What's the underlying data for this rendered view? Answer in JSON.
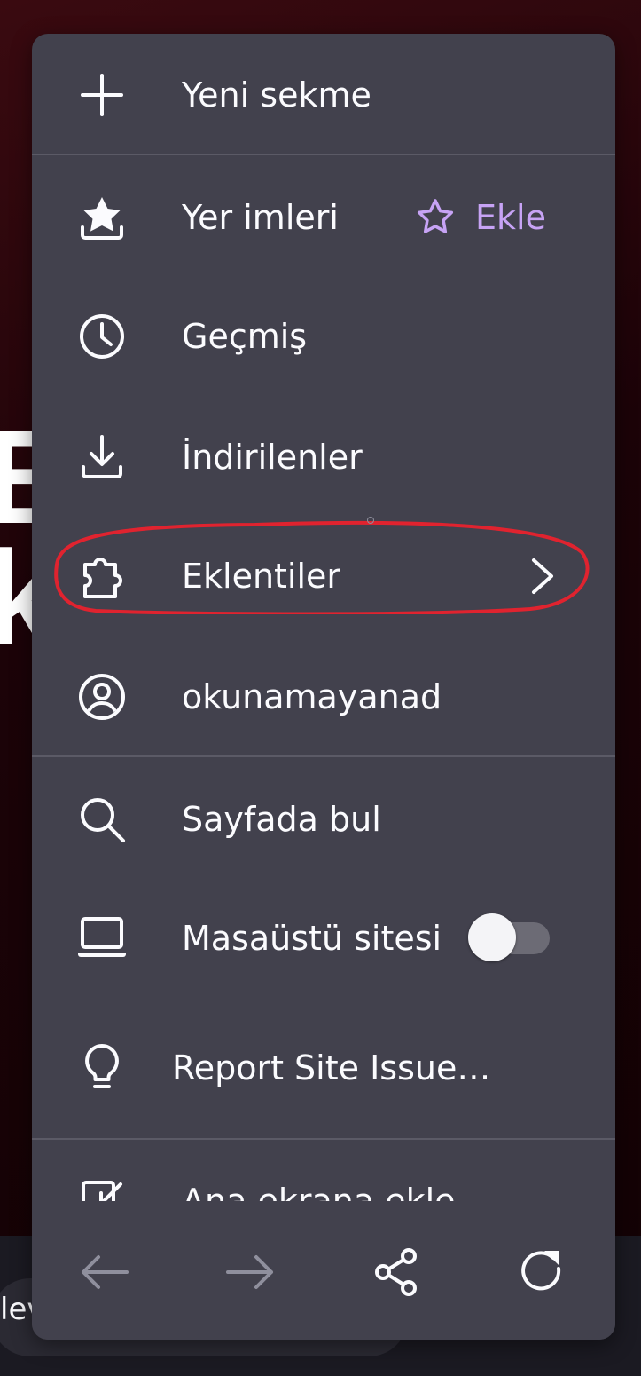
{
  "background": {
    "letters": [
      "E",
      "k"
    ],
    "snippet": "lev"
  },
  "menu": {
    "items": [
      {
        "label": "Yeni sekme",
        "icon": "plus-icon"
      },
      {
        "label": "Yer imleri",
        "icon": "bookmark-star-icon",
        "action_label": "Ekle",
        "action_icon": "star-outline-icon"
      },
      {
        "label": "Geçmiş",
        "icon": "clock-icon"
      },
      {
        "label": "İndirilenler",
        "icon": "download-icon"
      },
      {
        "label": "Eklentiler",
        "icon": "puzzle-icon",
        "trailing_icon": "chevron-right-icon"
      },
      {
        "label": "okunamayanad",
        "icon": "account-icon"
      },
      {
        "label": "Sayfada bul",
        "icon": "search-icon"
      },
      {
        "label": "Masaüstü sitesi",
        "icon": "laptop-icon",
        "toggle_on": false
      },
      {
        "label": "Report Site Issue…",
        "icon": "lightbulb-icon"
      },
      {
        "label": "Ana ekrana ekle",
        "icon": "add-to-homescreen-icon"
      }
    ]
  },
  "navbar": {
    "buttons": [
      {
        "name": "back",
        "icon": "arrow-left-icon",
        "enabled": false
      },
      {
        "name": "forward",
        "icon": "arrow-right-icon",
        "enabled": false
      },
      {
        "name": "share",
        "icon": "share-icon",
        "enabled": true
      },
      {
        "name": "reload",
        "icon": "reload-icon",
        "enabled": true
      }
    ]
  },
  "colors": {
    "menu_bg": "#42414d",
    "text": "#fbfbfe",
    "accent": "#c7a3f5",
    "highlight": "#e0232f",
    "disabled_icon": "#8f8f9d"
  }
}
